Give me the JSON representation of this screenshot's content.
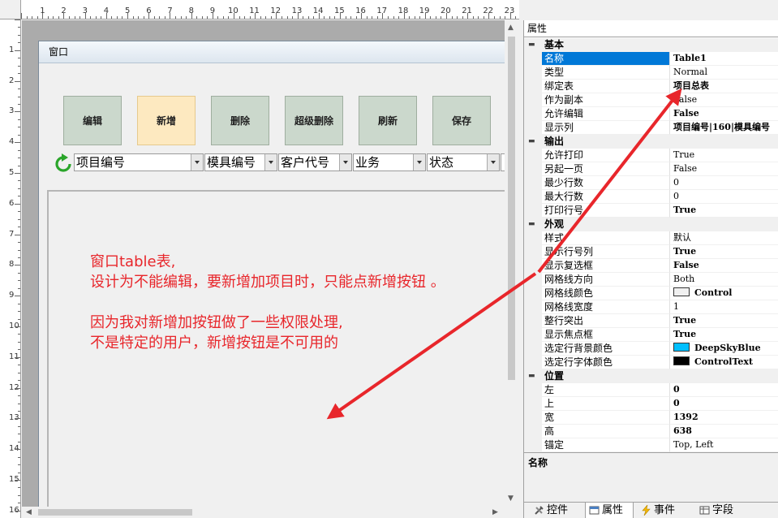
{
  "ruler": {
    "top_numbers": [
      "1",
      "2",
      "3",
      "4",
      "5",
      "6",
      "7",
      "8",
      "9",
      "10",
      "11",
      "12",
      "13",
      "14",
      "15",
      "16",
      "17",
      "18",
      "19",
      "20",
      "21",
      "22",
      "23"
    ],
    "left_numbers": [
      "1",
      "2",
      "3",
      "4",
      "5",
      "6",
      "7",
      "8",
      "9",
      "10",
      "11",
      "12",
      "13",
      "14",
      "15",
      "16"
    ]
  },
  "form": {
    "title": "窗口",
    "buttons": [
      {
        "label": "编辑",
        "active": false
      },
      {
        "label": "新增",
        "active": true
      },
      {
        "label": "删除",
        "active": false
      },
      {
        "label": "超级删除",
        "active": false
      },
      {
        "label": "刷新",
        "active": false
      },
      {
        "label": "保存",
        "active": false
      }
    ],
    "filters": [
      {
        "value": "项目编号"
      },
      {
        "value": "模具编号"
      },
      {
        "value": "客户代号"
      },
      {
        "value": "业务"
      },
      {
        "value": "状态"
      }
    ]
  },
  "annotation": {
    "lines": [
      "窗口table表,",
      "设计为不能编辑，要新增加项目时，只能点新增按钮 。",
      "",
      "因为我对新增加按钮做了一些权限处理,",
      "不是特定的用户，新增按钮是不可用的"
    ],
    "color": "#e8262b"
  },
  "properties": {
    "header": "属性",
    "categories": [
      {
        "name": "基本",
        "rows": [
          {
            "name": "名称",
            "value": "Table1",
            "bold": true,
            "selected": true
          },
          {
            "name": "类型",
            "value": "Normal",
            "bold": false
          },
          {
            "name": "绑定表",
            "value": "项目总表",
            "bold": true
          },
          {
            "name": "作为副本",
            "value": "False",
            "bold": false
          },
          {
            "name": "允许编辑",
            "value": "False",
            "bold": true
          },
          {
            "name": "显示列",
            "value": "项目编号|160|模具编号",
            "bold": true
          }
        ]
      },
      {
        "name": "输出",
        "rows": [
          {
            "name": "允许打印",
            "value": "True",
            "bold": false
          },
          {
            "name": "另起一页",
            "value": "False",
            "bold": false
          },
          {
            "name": "最少行数",
            "value": "0",
            "bold": false
          },
          {
            "name": "最大行数",
            "value": "0",
            "bold": false
          },
          {
            "name": "打印行号",
            "value": "True",
            "bold": true
          }
        ]
      },
      {
        "name": "外观",
        "rows": [
          {
            "name": "样式",
            "value": "默认",
            "bold": false
          },
          {
            "name": "显示行号列",
            "value": "True",
            "bold": true
          },
          {
            "name": "显示复选框",
            "value": "False",
            "bold": true
          },
          {
            "name": "网格线方向",
            "value": "Both",
            "bold": false
          },
          {
            "name": "网格线颜色",
            "value": "Control",
            "bold": true,
            "swatch": "#f0f0f0"
          },
          {
            "name": "网格线宽度",
            "value": "1",
            "bold": false
          },
          {
            "name": "整行突出",
            "value": "True",
            "bold": true
          },
          {
            "name": "显示焦点框",
            "value": "True",
            "bold": true
          },
          {
            "name": "选定行背景颜色",
            "value": "DeepSkyBlue",
            "bold": true,
            "swatch": "#00bfff"
          },
          {
            "name": "选定行字体颜色",
            "value": "ControlText",
            "bold": true,
            "swatch": "#000000"
          }
        ]
      },
      {
        "name": "位置",
        "rows": [
          {
            "name": "左",
            "value": "0",
            "bold": true
          },
          {
            "name": "上",
            "value": "0",
            "bold": true
          },
          {
            "name": "宽",
            "value": "1392",
            "bold": true
          },
          {
            "name": "高",
            "value": "638",
            "bold": true
          },
          {
            "name": "锚定",
            "value": "Top, Left",
            "bold": false
          }
        ]
      }
    ],
    "description_title": "名称"
  },
  "bottom_tabs": [
    {
      "label": "控件",
      "active": false
    },
    {
      "label": "属性",
      "active": true
    },
    {
      "label": "事件",
      "active": false
    },
    {
      "label": "字段",
      "active": false
    }
  ]
}
